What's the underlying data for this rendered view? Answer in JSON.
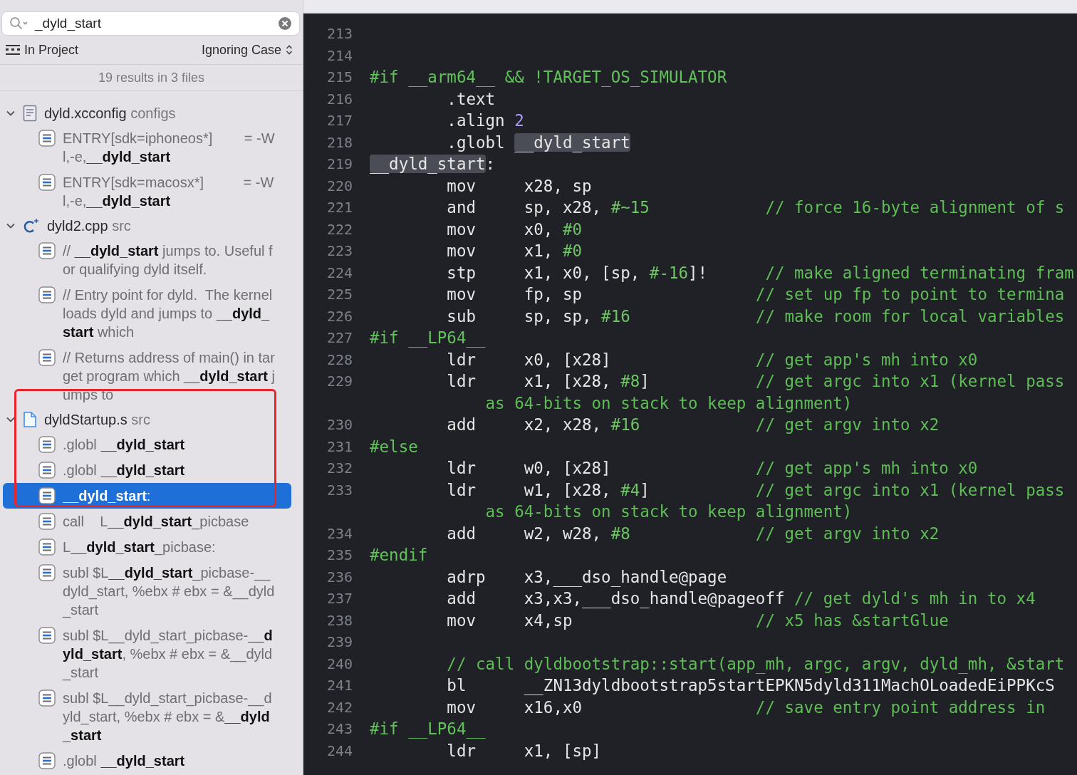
{
  "search": {
    "value": "_dyld_start"
  },
  "scope": "In Project",
  "case_mode": "Ignoring Case",
  "summary": "19 results in 3 files",
  "results": [
    {
      "file": "dyld.xcconfig",
      "folder": "configs",
      "kind": "config",
      "expanded": true,
      "matches": [
        {
          "text": "ENTRY[sdk=iphoneos*]        = -Wl,-e,**__dyld_start**",
          "selected": false
        },
        {
          "text": "ENTRY[sdk=macosx*]          = -Wl,-e,**__dyld_start**",
          "selected": false
        }
      ]
    },
    {
      "file": "dyld2.cpp",
      "folder": "src",
      "kind": "cpp",
      "expanded": true,
      "matches": [
        {
          "text": "// **__dyld_start** jumps to. Useful for qualifying dyld itself.",
          "selected": false
        },
        {
          "text": "// Entry point for dyld.  The kernel loads dyld and jumps to **__dyld_start** which",
          "selected": false
        },
        {
          "text": "// Returns address of main() in target program which **__dyld_start** jumps to",
          "selected": false
        }
      ]
    },
    {
      "file": "dyldStartup.s",
      "folder": "src",
      "kind": "asm",
      "expanded": true,
      "matches": [
        {
          "text": ".globl **__dyld_start**",
          "selected": false
        },
        {
          "text": ".globl **__dyld_start**",
          "selected": false
        },
        {
          "text": "**__dyld_start**:",
          "selected": true
        },
        {
          "text": "call    L**__dyld_start**_picbase",
          "selected": false
        },
        {
          "text": "L**__dyld_start**_picbase:",
          "selected": false
        },
        {
          "text": "subl $L**__dyld_start**_picbase-__dyld_start, %ebx # ebx = &__dyld_start",
          "selected": false
        },
        {
          "text": "subl $L__dyld_start_picbase-**__dyld_start**, %ebx # ebx = &__dyld_start",
          "selected": false
        },
        {
          "text": "subl $L__dyld_start_picbase-__dyld_start, %ebx # ebx = &**__dyld_start**",
          "selected": false
        },
        {
          "text": ".globl **__dyld_start**",
          "selected": false
        }
      ]
    }
  ],
  "editor": {
    "lines": [
      {
        "number": "213"
      },
      {
        "number": "214"
      },
      {
        "number": "215",
        "segments": [
          {
            "text": "#if __arm64__ && !TARGET_OS_SIMULATOR",
            "kind": "directive"
          }
        ]
      },
      {
        "number": "216",
        "segments": [
          {
            "text": "        .text",
            "kind": "plain"
          }
        ]
      },
      {
        "number": "217",
        "segments": [
          {
            "text": "        .align ",
            "kind": "plain"
          },
          {
            "text": "2",
            "kind": "literal"
          }
        ]
      },
      {
        "number": "218",
        "segments": [
          {
            "text": "        .globl ",
            "kind": "plain"
          },
          {
            "text": "__dyld_start",
            "kind": "match"
          }
        ]
      },
      {
        "number": "219",
        "segments": [
          {
            "text": "__dyld_start",
            "kind": "match"
          },
          {
            "text": ":",
            "kind": "plain"
          }
        ]
      },
      {
        "number": "220",
        "segments": [
          {
            "text": "        mov     x28, sp",
            "kind": "plain"
          }
        ]
      },
      {
        "number": "221",
        "segments": [
          {
            "text": "        and     sp, x28, ",
            "kind": "plain"
          },
          {
            "text": "#~15            ",
            "kind": "number"
          },
          {
            "text": "// force 16-byte alignment of s",
            "kind": "comment"
          }
        ]
      },
      {
        "number": "222",
        "segments": [
          {
            "text": "        mov     x0, ",
            "kind": "plain"
          },
          {
            "text": "#0",
            "kind": "number"
          }
        ]
      },
      {
        "number": "223",
        "segments": [
          {
            "text": "        mov     x1, ",
            "kind": "plain"
          },
          {
            "text": "#0",
            "kind": "number"
          }
        ]
      },
      {
        "number": "224",
        "segments": [
          {
            "text": "        stp     x1, x0, [sp, ",
            "kind": "plain"
          },
          {
            "text": "#-16",
            "kind": "number"
          },
          {
            "text": "]!      ",
            "kind": "plain"
          },
          {
            "text": "// make aligned terminating fram",
            "kind": "comment"
          }
        ]
      },
      {
        "number": "225",
        "segments": [
          {
            "text": "        mov     fp, sp                  ",
            "kind": "plain"
          },
          {
            "text": "// set up fp to point to termina",
            "kind": "comment"
          }
        ]
      },
      {
        "number": "226",
        "segments": [
          {
            "text": "        sub     sp, sp, ",
            "kind": "plain"
          },
          {
            "text": "#16             ",
            "kind": "number"
          },
          {
            "text": "// make room for local variables",
            "kind": "comment"
          }
        ]
      },
      {
        "number": "227",
        "segments": [
          {
            "text": "#if __LP64__",
            "kind": "directive"
          }
        ]
      },
      {
        "number": "228",
        "segments": [
          {
            "text": "        ldr     x0, [x28]               ",
            "kind": "plain"
          },
          {
            "text": "// get app's mh into x0",
            "kind": "comment"
          }
        ]
      },
      {
        "number": "229",
        "segments": [
          {
            "text": "        ldr     x1, [x28, ",
            "kind": "plain"
          },
          {
            "text": "#8",
            "kind": "number"
          },
          {
            "text": "]           ",
            "kind": "plain"
          },
          {
            "text": "// get argc into x1 (kernel pass",
            "kind": "comment"
          }
        ],
        "continuation": "as 64-bits on stack to keep alignment)"
      },
      {
        "number": "230",
        "segments": [
          {
            "text": "        add     x2, x28, ",
            "kind": "plain"
          },
          {
            "text": "#16            ",
            "kind": "number"
          },
          {
            "text": "// get argv into x2",
            "kind": "comment"
          }
        ]
      },
      {
        "number": "231",
        "segments": [
          {
            "text": "#else",
            "kind": "directive"
          }
        ]
      },
      {
        "number": "232",
        "segments": [
          {
            "text": "        ldr     w0, [x28]               ",
            "kind": "plain"
          },
          {
            "text": "// get app's mh into x0",
            "kind": "comment"
          }
        ]
      },
      {
        "number": "233",
        "segments": [
          {
            "text": "        ldr     w1, [x28, ",
            "kind": "plain"
          },
          {
            "text": "#4",
            "kind": "number"
          },
          {
            "text": "]           ",
            "kind": "plain"
          },
          {
            "text": "// get argc into x1 (kernel pass",
            "kind": "comment"
          }
        ],
        "continuation": "as 64-bits on stack to keep alignment)"
      },
      {
        "number": "234",
        "segments": [
          {
            "text": "        add     w2, w28, ",
            "kind": "plain"
          },
          {
            "text": "#8             ",
            "kind": "number"
          },
          {
            "text": "// get argv into x2",
            "kind": "comment"
          }
        ]
      },
      {
        "number": "235",
        "segments": [
          {
            "text": "#endif",
            "kind": "directive"
          }
        ]
      },
      {
        "number": "236",
        "segments": [
          {
            "text": "        adrp    x3,___dso_handle@page",
            "kind": "plain"
          }
        ]
      },
      {
        "number": "237",
        "segments": [
          {
            "text": "        add     x3,x3,___dso_handle@pageoff ",
            "kind": "plain"
          },
          {
            "text": "// get dyld's mh in to x4",
            "kind": "comment"
          }
        ]
      },
      {
        "number": "238",
        "segments": [
          {
            "text": "        mov     x4,sp                   ",
            "kind": "plain"
          },
          {
            "text": "// x5 has &startGlue",
            "kind": "comment"
          }
        ]
      },
      {
        "number": "239"
      },
      {
        "number": "240",
        "segments": [
          {
            "text": "        // call dyldbootstrap::start(app_mh, argc, argv, dyld_mh, &start",
            "kind": "comment"
          }
        ]
      },
      {
        "number": "241",
        "segments": [
          {
            "text": "        bl      __ZN13dyldbootstrap5startEPKN5dyld311MachOLoadedEiPPKcS",
            "kind": "plain"
          }
        ]
      },
      {
        "number": "242",
        "segments": [
          {
            "text": "        mov     x16,x0                  ",
            "kind": "plain"
          },
          {
            "text": "// save entry point address in",
            "kind": "comment"
          }
        ]
      },
      {
        "number": "243",
        "segments": [
          {
            "text": "#if __LP64__",
            "kind": "directive"
          }
        ]
      },
      {
        "number": "244",
        "segments": [
          {
            "text": "        ldr     x1, [sp]",
            "kind": "plain"
          }
        ]
      }
    ]
  }
}
